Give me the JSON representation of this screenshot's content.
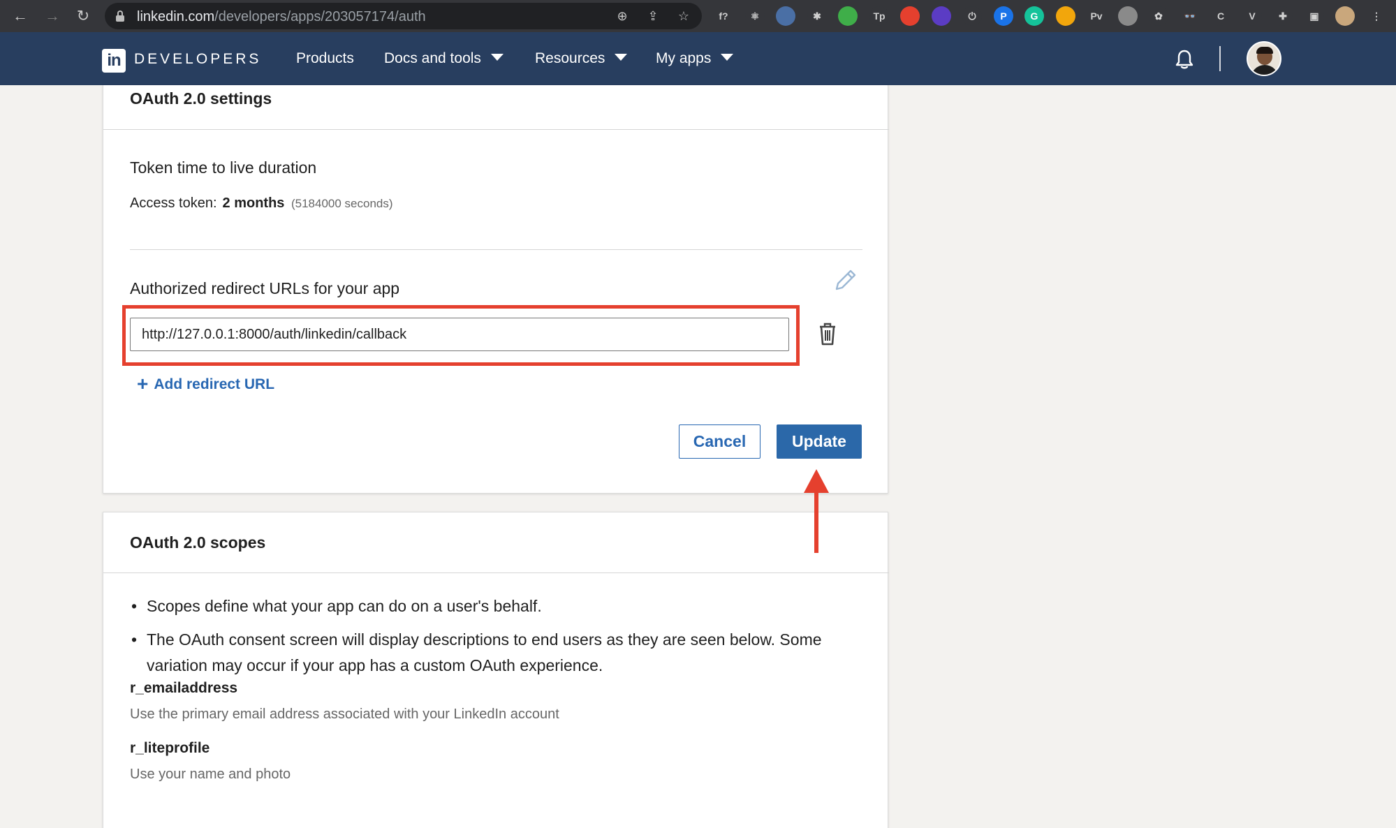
{
  "browser": {
    "url_host": "linkedin.com",
    "url_path": "/developers/apps/203057174/auth",
    "extensions": [
      {
        "name": "font-ext-icon",
        "label": "f?",
        "color": "#35363a"
      },
      {
        "name": "react-devtools-icon",
        "label": "⚛",
        "color": "#35363a"
      },
      {
        "name": "circle-ext-icon",
        "label": "",
        "color": "#4a6fa5"
      },
      {
        "name": "gear-ext-icon",
        "label": "✱",
        "color": "#35363a"
      },
      {
        "name": "leaf-ext-icon",
        "label": "",
        "color": "#3fae49"
      },
      {
        "name": "tp-ext-icon",
        "label": "Tp",
        "color": "#35363a"
      },
      {
        "name": "color-wheel-ext-icon",
        "label": "",
        "color": "#e5402e"
      },
      {
        "name": "layers-ext-icon",
        "label": "",
        "color": "#5b3cc4"
      },
      {
        "name": "power-ext-icon",
        "label": "⏻",
        "color": "#35363a"
      },
      {
        "name": "p-ext-icon",
        "label": "P",
        "color": "#1a73e8"
      },
      {
        "name": "grammarly-ext-icon",
        "label": "G",
        "color": "#15c39a"
      },
      {
        "name": "chrome-ext-icon",
        "label": "",
        "color": "#f2a60c"
      },
      {
        "name": "pv-ext-icon",
        "label": "Pv",
        "color": "#35363a"
      },
      {
        "name": "gray-dot-ext-icon",
        "label": "",
        "color": "#8a8a8a"
      },
      {
        "name": "openai-ext-icon",
        "label": "✿",
        "color": "#35363a"
      },
      {
        "name": "glasses-ext-icon",
        "label": "👓",
        "color": "#35363a"
      },
      {
        "name": "c-ext-icon",
        "label": "C",
        "color": "#35363a"
      },
      {
        "name": "v-ext-icon",
        "label": "V",
        "color": "#35363a"
      },
      {
        "name": "puzzle-icon",
        "label": "✚",
        "color": "#35363a"
      },
      {
        "name": "sidebar-icon",
        "label": "▣",
        "color": "#35363a"
      },
      {
        "name": "profile-icon",
        "label": "",
        "color": "#c9a77c"
      },
      {
        "name": "kebab-menu-icon",
        "label": "⋮",
        "color": "#35363a"
      }
    ]
  },
  "header": {
    "logo_mark": "in",
    "logo_text": "DEVELOPERS",
    "menu": {
      "products": "Products",
      "docs": "Docs and tools",
      "resources": "Resources",
      "myapps": "My apps"
    }
  },
  "oauth_settings": {
    "title": "OAuth 2.0 settings",
    "token_heading": "Token time to live duration",
    "access_token_label": "Access token:",
    "access_token_value": "2 months",
    "access_token_seconds": "(5184000 seconds)",
    "redirect_heading": "Authorized redirect URLs for your app",
    "redirect_url": "http://127.0.0.1:8000/auth/linkedin/callback",
    "add_redirect_label": "Add redirect URL",
    "cancel_label": "Cancel",
    "update_label": "Update"
  },
  "oauth_scopes": {
    "title": "OAuth 2.0 scopes",
    "bullets": [
      "Scopes define what your app can do on a user's behalf.",
      "The OAuth consent screen will display descriptions to end users as they are seen below. Some variation may occur if your app has a custom OAuth experience."
    ],
    "scopes": [
      {
        "name": "r_emailaddress",
        "description": "Use the primary email address associated with your LinkedIn account"
      },
      {
        "name": "r_liteprofile",
        "description": "Use your name and photo"
      }
    ]
  },
  "colors": {
    "header_bg": "#283e5f",
    "link_blue": "#2867b2",
    "update_blue": "#2b68a9",
    "annotation_red": "#e5402e",
    "page_bg": "#f3f2ef"
  }
}
